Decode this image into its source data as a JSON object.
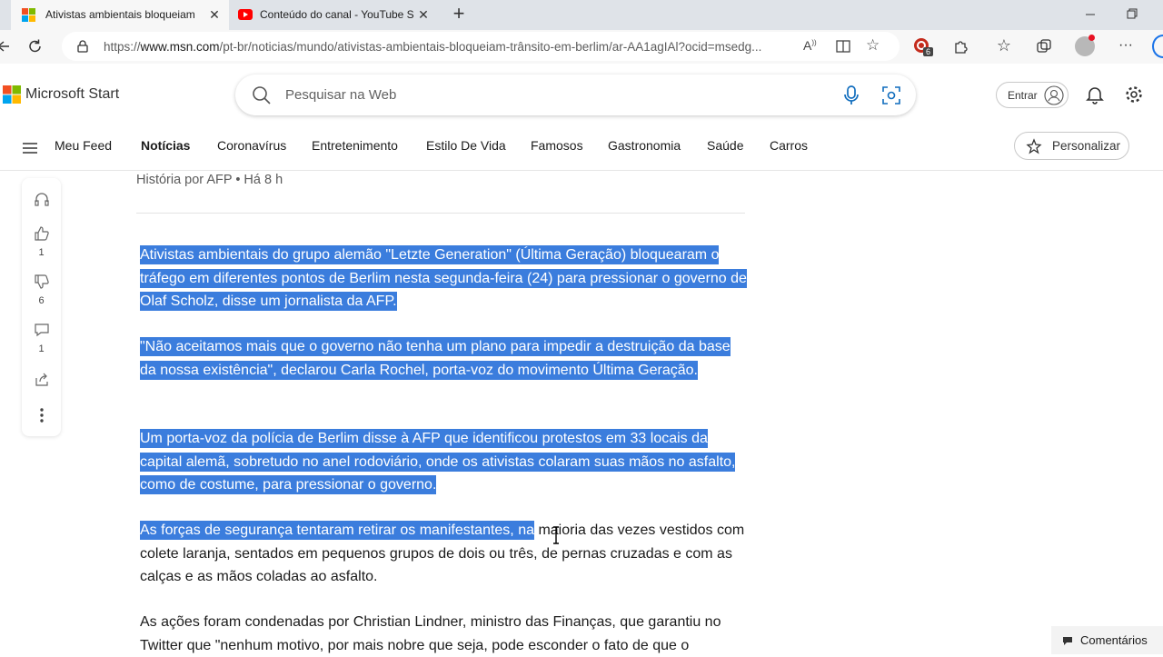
{
  "browser": {
    "tabs": [
      {
        "title": "Ativistas ambientais bloqueiam tr",
        "favicon": "msn-icon",
        "active": true
      },
      {
        "title": "Conteúdo do canal - YouTube St",
        "favicon": "youtube-icon",
        "active": false
      }
    ],
    "new_tab_label": "+",
    "url_prefix": "https://",
    "url_host": "www.msn.com",
    "url_path": "/pt-br/noticias/mundo/ativistas-ambientais-bloqueiam-trânsito-em-berlim/ar-AA1agIAl?ocid=msedg...",
    "extension_badge": "6"
  },
  "header": {
    "brand": "Microsoft Start",
    "search_placeholder": "Pesquisar na Web",
    "signin_label": "Entrar"
  },
  "nav": {
    "items": [
      "Meu Feed",
      "Notícias",
      "Coronavírus",
      "Entretenimento",
      "Estilo De Vida",
      "Famosos",
      "Gastronomia",
      "Saúde",
      "Carros"
    ],
    "active": "Notícias",
    "personalize_label": "Personalizar"
  },
  "rail": {
    "likes": "1",
    "dislikes": "6",
    "comments": "1"
  },
  "article": {
    "byline": "História por AFP • Há 8 h",
    "paragraphs": [
      {
        "selected": "Ativistas ambientais do grupo alemão \"Letzte Generation\" (Última Geração) bloquearam o tráfego em diferentes pontos de Berlim nesta segunda-feira (24) para pressionar o governo de Olaf Scholz, disse um jornalista da AFP.",
        "rest": ""
      },
      {
        "selected": "\"Não aceitamos mais que o governo não tenha um plano para impedir a destruição da base da nossa existência\", declarou Carla Rochel, porta-voz do movimento Última Geração. ",
        "rest": ""
      },
      {
        "selected": "Um porta-voz da polícia de Berlim disse à AFP que identificou protestos em 33 locais da capital alemã, sobretudo no anel rodoviário, onde os ativistas colaram suas mãos no asfalto, como de costume, para pressionar o governo.",
        "rest": ""
      },
      {
        "selected": "As forças de segurança tentaram retirar os manifestantes, na",
        "rest": " maioria das vezes vestidos com colete laranja, sentados em pequenos grupos de dois ou três, de pernas cruzadas e com as calças e as mãos coladas ao asfalto."
      },
      {
        "selected": "",
        "rest": "As ações foram condenadas por Christian Lindner, ministro das Finanças, que garantiu no Twitter que \"nenhum motivo, por mais nobre que seja, pode esconder o fato de que o"
      }
    ]
  },
  "comments_button": "Comentários",
  "colors": {
    "selection": "#3b7ddd",
    "tabbar": "#dfe3e8",
    "toolbar": "#f7f7f7",
    "mic_blue": "#0f6cbd"
  }
}
